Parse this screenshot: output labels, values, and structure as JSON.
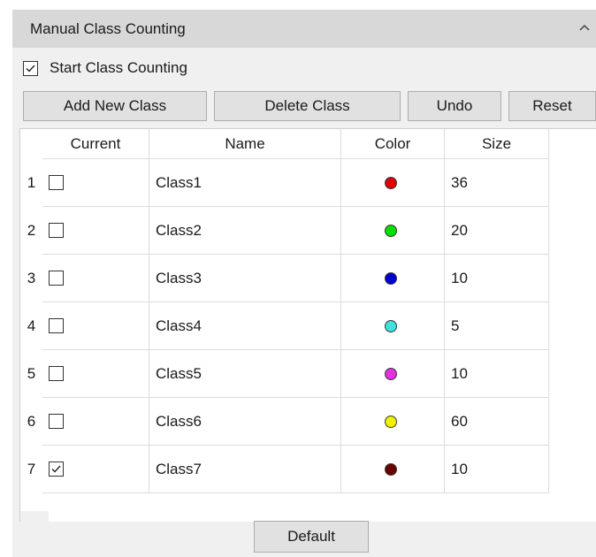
{
  "panel": {
    "title": "Manual Class Counting",
    "collapse_icon": "chevron-up-icon"
  },
  "start_counting": {
    "label": "Start Class Counting",
    "checked": true
  },
  "toolbar": {
    "add_label": "Add New Class",
    "delete_label": "Delete Class",
    "undo_label": "Undo",
    "reset_label": "Reset"
  },
  "table": {
    "columns": [
      "Current",
      "Name",
      "Color",
      "Size"
    ],
    "rows": [
      {
        "index": "1",
        "current": false,
        "name": "Class1",
        "color": "#e00000",
        "size": "36"
      },
      {
        "index": "2",
        "current": false,
        "name": "Class2",
        "color": "#00e000",
        "size": "20"
      },
      {
        "index": "3",
        "current": false,
        "name": "Class3",
        "color": "#0000d0",
        "size": "10"
      },
      {
        "index": "4",
        "current": false,
        "name": "Class4",
        "color": "#40e0e0",
        "size": "5"
      },
      {
        "index": "5",
        "current": false,
        "name": "Class5",
        "color": "#e030e0",
        "size": "10"
      },
      {
        "index": "6",
        "current": false,
        "name": "Class6",
        "color": "#f0f000",
        "size": "60"
      },
      {
        "index": "7",
        "current": true,
        "name": "Class7",
        "color": "#6a0000",
        "size": "10"
      }
    ]
  },
  "footer": {
    "default_label": "Default"
  }
}
